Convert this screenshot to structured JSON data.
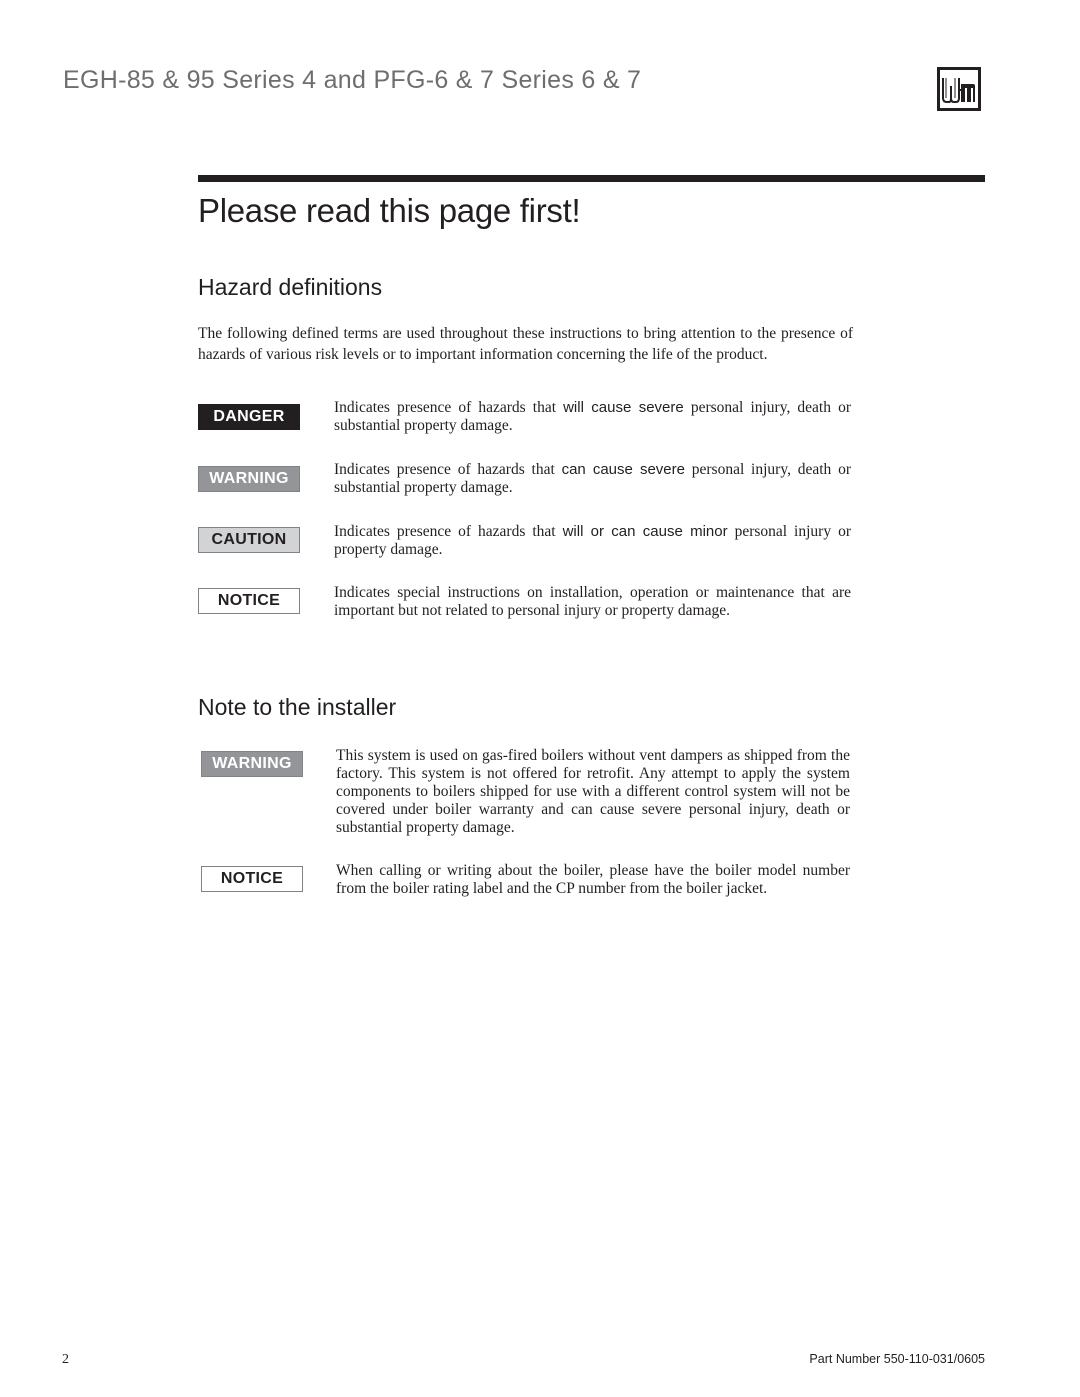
{
  "header": {
    "title": "EGH-85 & 95 Series 4 and PFG-6 & 7 Series 6 & 7",
    "logo_text": "WM"
  },
  "page_title": "Please read this page first!",
  "hazard_section": {
    "heading": "Hazard definitions",
    "intro": "The following defined terms are used throughout these instructions to bring attention to the presence of hazards of various risk levels or to important information concerning the life of the product.",
    "items": [
      {
        "label": "DANGER",
        "text_before": "Indicates presence of hazards that ",
        "emphasis": "will cause severe",
        "text_after": " personal injury, death or substantial property damage."
      },
      {
        "label": "WARNING",
        "text_before": "Indicates presence of hazards that ",
        "emphasis": "can cause severe",
        "text_after": " personal injury, death or substantial property damage."
      },
      {
        "label": "CAUTION",
        "text_before": "Indicates presence of hazards that ",
        "emphasis": "will or can cause minor",
        "text_after": " personal injury or property damage."
      },
      {
        "label": "NOTICE",
        "text_before": "Indicates special instructions on installation, operation or maintenance that are important but not related to personal injury or property damage.",
        "emphasis": "",
        "text_after": ""
      }
    ]
  },
  "installer_section": {
    "heading": "Note to the installer",
    "items": [
      {
        "label": "WARNING",
        "text": "This system is used on gas-fired boilers without vent dampers as shipped from the factory. This system is not offered for retrofit. Any attempt to apply the system components to boilers shipped for use with a different control system will not be covered under boiler warranty and can cause severe personal injury, death or substantial property damage."
      },
      {
        "label": "NOTICE",
        "text": "When calling or writing about the boiler, please have the boiler model number from the boiler rating label and the CP number from the boiler jacket."
      }
    ]
  },
  "footer": {
    "page_number": "2",
    "part_number": "Part Number 550-110-031/0605"
  },
  "colors": {
    "text": "#231f20",
    "header_gray": "#6d6e71",
    "danger_bg": "#231f20",
    "warning_bg": "#939598",
    "caution_bg": "#d1d3d4",
    "notice_bg": "#ffffff"
  }
}
